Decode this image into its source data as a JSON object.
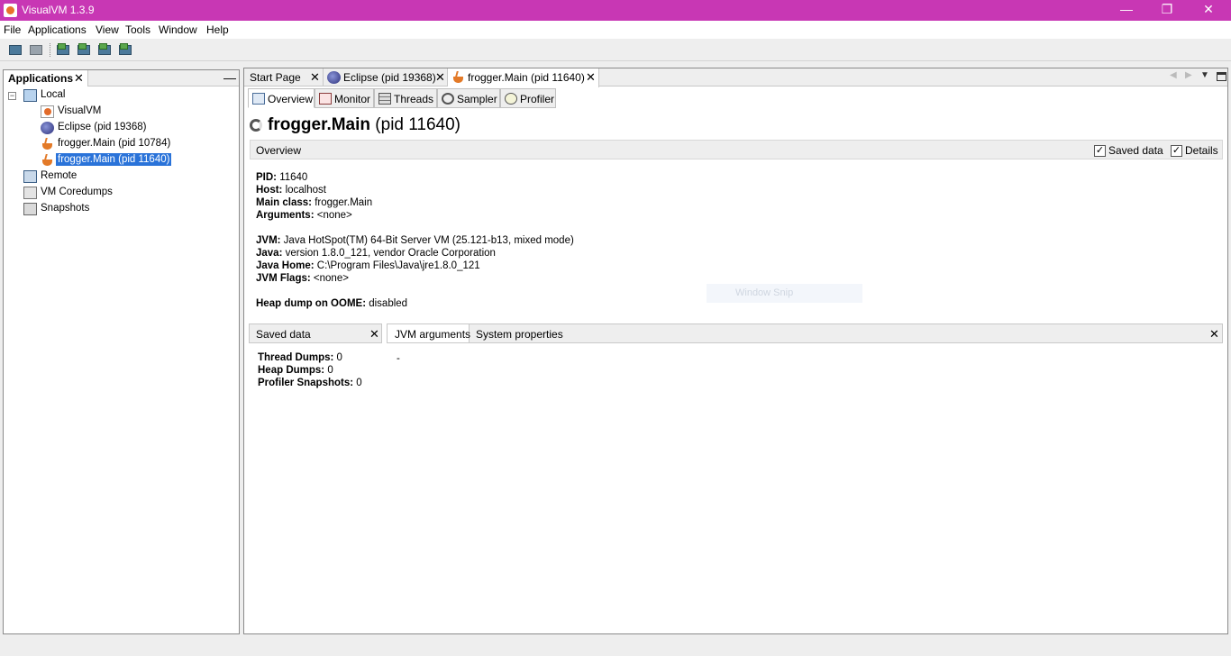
{
  "window": {
    "title": "VisualVM 1.3.9",
    "minimize_glyph": "—",
    "restore_glyph": "❐",
    "close_glyph": "✕"
  },
  "menu": [
    "File",
    "Applications",
    "View",
    "Tools",
    "Window",
    "Help"
  ],
  "toolbar": {
    "buttons": [
      "load-snapshot",
      "save",
      "heap-dump",
      "thread-dump",
      "profiler-snapshot",
      "application-snapshot"
    ]
  },
  "left_panel": {
    "tab_label": "Applications",
    "tab_close": "✕",
    "minimize": "—",
    "tree": {
      "local": "Local",
      "local_children": [
        "VisualVM",
        "Eclipse (pid 19368)",
        "frogger.Main (pid 10784)",
        "frogger.Main (pid 11640)"
      ],
      "selected": "frogger.Main (pid 11640)",
      "remote": "Remote",
      "coredumps": "VM Coredumps",
      "snapshots": "Snapshots"
    }
  },
  "doc_tabs": [
    {
      "label": "Start Page",
      "close": "✕"
    },
    {
      "label": "Eclipse (pid 19368)",
      "close": "✕"
    },
    {
      "label": "frogger.Main (pid 11640)",
      "close": "✕",
      "active": true
    }
  ],
  "sub_tabs": [
    "Overview",
    "Monitor",
    "Threads",
    "Sampler",
    "Profiler"
  ],
  "page": {
    "title_bold": "frogger.Main",
    "title_rest": " (pid 11640)",
    "section_title": "Overview",
    "saved_data_label": "Saved data",
    "details_label": "Details",
    "check": "✓"
  },
  "info": {
    "pid_k": "PID:",
    "pid_v": " 11640",
    "host_k": "Host:",
    "host_v": " localhost",
    "main_k": "Main class:",
    "main_v": " frogger.Main",
    "args_k": "Arguments:",
    "args_v": " <none>",
    "jvm_k": "JVM:",
    "jvm_v": " Java HotSpot(TM) 64-Bit Server VM (25.121-b13, mixed mode)",
    "java_k": "Java:",
    "java_v": " version 1.8.0_121, vendor Oracle Corporation",
    "home_k": "Java Home:",
    "home_v": " C:\\Program Files\\Java\\jre1.8.0_121",
    "flags_k": "JVM Flags:",
    "flags_v": " <none>",
    "oome_k": "Heap dump on OOME:",
    "oome_v": " disabled"
  },
  "ghost_text": "Window Snip",
  "lower": {
    "saved_data_tab": "Saved data",
    "close": "✕",
    "jvm_args_tab": "JVM arguments",
    "sys_props_tab": "System properties",
    "thread_dumps_k": "Thread Dumps:",
    "thread_dumps_v": " 0",
    "heap_dumps_k": "Heap Dumps:",
    "heap_dumps_v": " 0",
    "prof_snap_k": "Profiler Snapshots:",
    "prof_snap_v": " 0",
    "jvm_args_value": "-"
  }
}
